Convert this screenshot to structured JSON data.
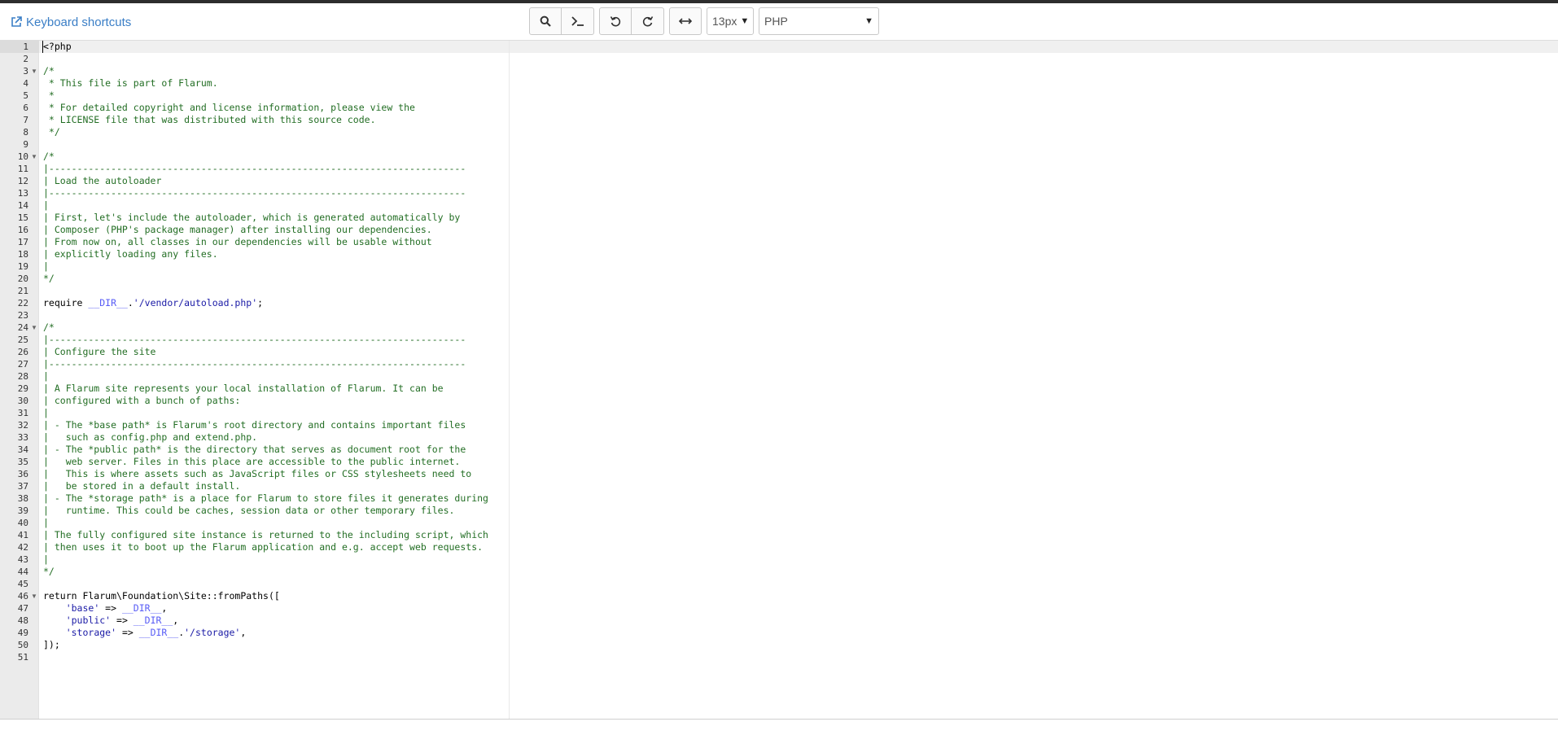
{
  "header": {
    "shortcuts_label": "Keyboard shortcuts",
    "font_size": "13px",
    "language": "PHP"
  },
  "toolbar": {
    "icons": [
      "search-icon",
      "terminal-icon",
      "undo-icon",
      "redo-icon",
      "wrap-icon"
    ]
  },
  "colors": {
    "link": "#3a7ec6",
    "comment": "#236e24",
    "string": "#1a1aa6",
    "constant": "#585cf6"
  },
  "editor": {
    "active_line": 1,
    "lines": [
      {
        "n": "1",
        "fold": false,
        "tokens": [
          {
            "t": "<?php",
            "c": "plain"
          }
        ]
      },
      {
        "n": "2",
        "fold": false,
        "tokens": []
      },
      {
        "n": "3",
        "fold": true,
        "tokens": [
          {
            "t": "/*",
            "c": "comment"
          }
        ]
      },
      {
        "n": "4",
        "fold": false,
        "tokens": [
          {
            "t": " * This file is part of Flarum.",
            "c": "comment"
          }
        ]
      },
      {
        "n": "5",
        "fold": false,
        "tokens": [
          {
            "t": " *",
            "c": "comment"
          }
        ]
      },
      {
        "n": "6",
        "fold": false,
        "tokens": [
          {
            "t": " * For detailed copyright and license information, please view the",
            "c": "comment"
          }
        ]
      },
      {
        "n": "7",
        "fold": false,
        "tokens": [
          {
            "t": " * LICENSE file that was distributed with this source code.",
            "c": "comment"
          }
        ]
      },
      {
        "n": "8",
        "fold": false,
        "tokens": [
          {
            "t": " */",
            "c": "comment"
          }
        ]
      },
      {
        "n": "9",
        "fold": false,
        "tokens": []
      },
      {
        "n": "10",
        "fold": true,
        "tokens": [
          {
            "t": "/*",
            "c": "comment"
          }
        ]
      },
      {
        "n": "11",
        "fold": false,
        "tokens": [
          {
            "t": "|--------------------------------------------------------------------------",
            "c": "comment"
          }
        ]
      },
      {
        "n": "12",
        "fold": false,
        "tokens": [
          {
            "t": "| Load the autoloader",
            "c": "comment"
          }
        ]
      },
      {
        "n": "13",
        "fold": false,
        "tokens": [
          {
            "t": "|--------------------------------------------------------------------------",
            "c": "comment"
          }
        ]
      },
      {
        "n": "14",
        "fold": false,
        "tokens": [
          {
            "t": "|",
            "c": "comment"
          }
        ]
      },
      {
        "n": "15",
        "fold": false,
        "tokens": [
          {
            "t": "| First, let's include the autoloader, which is generated automatically by",
            "c": "comment"
          }
        ]
      },
      {
        "n": "16",
        "fold": false,
        "tokens": [
          {
            "t": "| Composer (PHP's package manager) after installing our dependencies.",
            "c": "comment"
          }
        ]
      },
      {
        "n": "17",
        "fold": false,
        "tokens": [
          {
            "t": "| From now on, all classes in our dependencies will be usable without",
            "c": "comment"
          }
        ]
      },
      {
        "n": "18",
        "fold": false,
        "tokens": [
          {
            "t": "| explicitly loading any files.",
            "c": "comment"
          }
        ]
      },
      {
        "n": "19",
        "fold": false,
        "tokens": [
          {
            "t": "|",
            "c": "comment"
          }
        ]
      },
      {
        "n": "20",
        "fold": false,
        "tokens": [
          {
            "t": "*/",
            "c": "comment"
          }
        ]
      },
      {
        "n": "21",
        "fold": false,
        "tokens": []
      },
      {
        "n": "22",
        "fold": false,
        "tokens": [
          {
            "t": "require ",
            "c": "plain"
          },
          {
            "t": "__DIR__",
            "c": "const"
          },
          {
            "t": ".",
            "c": "plain"
          },
          {
            "t": "'/vendor/autoload.php'",
            "c": "string"
          },
          {
            "t": ";",
            "c": "plain"
          }
        ]
      },
      {
        "n": "23",
        "fold": false,
        "tokens": []
      },
      {
        "n": "24",
        "fold": true,
        "tokens": [
          {
            "t": "/*",
            "c": "comment"
          }
        ]
      },
      {
        "n": "25",
        "fold": false,
        "tokens": [
          {
            "t": "|--------------------------------------------------------------------------",
            "c": "comment"
          }
        ]
      },
      {
        "n": "26",
        "fold": false,
        "tokens": [
          {
            "t": "| Configure the site",
            "c": "comment"
          }
        ]
      },
      {
        "n": "27",
        "fold": false,
        "tokens": [
          {
            "t": "|--------------------------------------------------------------------------",
            "c": "comment"
          }
        ]
      },
      {
        "n": "28",
        "fold": false,
        "tokens": [
          {
            "t": "|",
            "c": "comment"
          }
        ]
      },
      {
        "n": "29",
        "fold": false,
        "tokens": [
          {
            "t": "| A Flarum site represents your local installation of Flarum. It can be",
            "c": "comment"
          }
        ]
      },
      {
        "n": "30",
        "fold": false,
        "tokens": [
          {
            "t": "| configured with a bunch of paths:",
            "c": "comment"
          }
        ]
      },
      {
        "n": "31",
        "fold": false,
        "tokens": [
          {
            "t": "|",
            "c": "comment"
          }
        ]
      },
      {
        "n": "32",
        "fold": false,
        "tokens": [
          {
            "t": "| - The *base path* is Flarum's root directory and contains important files",
            "c": "comment"
          }
        ]
      },
      {
        "n": "33",
        "fold": false,
        "tokens": [
          {
            "t": "|   such as config.php and extend.php.",
            "c": "comment"
          }
        ]
      },
      {
        "n": "34",
        "fold": false,
        "tokens": [
          {
            "t": "| - The *public path* is the directory that serves as document root for the",
            "c": "comment"
          }
        ]
      },
      {
        "n": "35",
        "fold": false,
        "tokens": [
          {
            "t": "|   web server. Files in this place are accessible to the public internet.",
            "c": "comment"
          }
        ]
      },
      {
        "n": "36",
        "fold": false,
        "tokens": [
          {
            "t": "|   This is where assets such as JavaScript files or CSS stylesheets need to",
            "c": "comment"
          }
        ]
      },
      {
        "n": "37",
        "fold": false,
        "tokens": [
          {
            "t": "|   be stored in a default install.",
            "c": "comment"
          }
        ]
      },
      {
        "n": "38",
        "fold": false,
        "tokens": [
          {
            "t": "| - The *storage path* is a place for Flarum to store files it generates during",
            "c": "comment"
          }
        ]
      },
      {
        "n": "39",
        "fold": false,
        "tokens": [
          {
            "t": "|   runtime. This could be caches, session data or other temporary files.",
            "c": "comment"
          }
        ]
      },
      {
        "n": "40",
        "fold": false,
        "tokens": [
          {
            "t": "|",
            "c": "comment"
          }
        ]
      },
      {
        "n": "41",
        "fold": false,
        "tokens": [
          {
            "t": "| The fully configured site instance is returned to the including script, which",
            "c": "comment"
          }
        ]
      },
      {
        "n": "42",
        "fold": false,
        "tokens": [
          {
            "t": "| then uses it to boot up the Flarum application and e.g. accept web requests.",
            "c": "comment"
          }
        ]
      },
      {
        "n": "43",
        "fold": false,
        "tokens": [
          {
            "t": "|",
            "c": "comment"
          }
        ]
      },
      {
        "n": "44",
        "fold": false,
        "tokens": [
          {
            "t": "*/",
            "c": "comment"
          }
        ]
      },
      {
        "n": "45",
        "fold": false,
        "tokens": []
      },
      {
        "n": "46",
        "fold": true,
        "tokens": [
          {
            "t": "return Flarum\\Foundation\\Site::fromPaths([",
            "c": "plain"
          }
        ]
      },
      {
        "n": "47",
        "fold": false,
        "tokens": [
          {
            "t": "    ",
            "c": "plain"
          },
          {
            "t": "'base'",
            "c": "string"
          },
          {
            "t": " => ",
            "c": "plain"
          },
          {
            "t": "__DIR__",
            "c": "const"
          },
          {
            "t": ",",
            "c": "plain"
          }
        ]
      },
      {
        "n": "48",
        "fold": false,
        "tokens": [
          {
            "t": "    ",
            "c": "plain"
          },
          {
            "t": "'public'",
            "c": "string"
          },
          {
            "t": " => ",
            "c": "plain"
          },
          {
            "t": "__DIR__",
            "c": "const"
          },
          {
            "t": ",",
            "c": "plain"
          }
        ]
      },
      {
        "n": "49",
        "fold": false,
        "tokens": [
          {
            "t": "    ",
            "c": "plain"
          },
          {
            "t": "'storage'",
            "c": "string"
          },
          {
            "t": " => ",
            "c": "plain"
          },
          {
            "t": "__DIR__",
            "c": "const"
          },
          {
            "t": ".",
            "c": "plain"
          },
          {
            "t": "'/storage'",
            "c": "string"
          },
          {
            "t": ",",
            "c": "plain"
          }
        ]
      },
      {
        "n": "50",
        "fold": false,
        "tokens": [
          {
            "t": "]);",
            "c": "plain"
          }
        ]
      },
      {
        "n": "51",
        "fold": false,
        "tokens": []
      }
    ]
  }
}
